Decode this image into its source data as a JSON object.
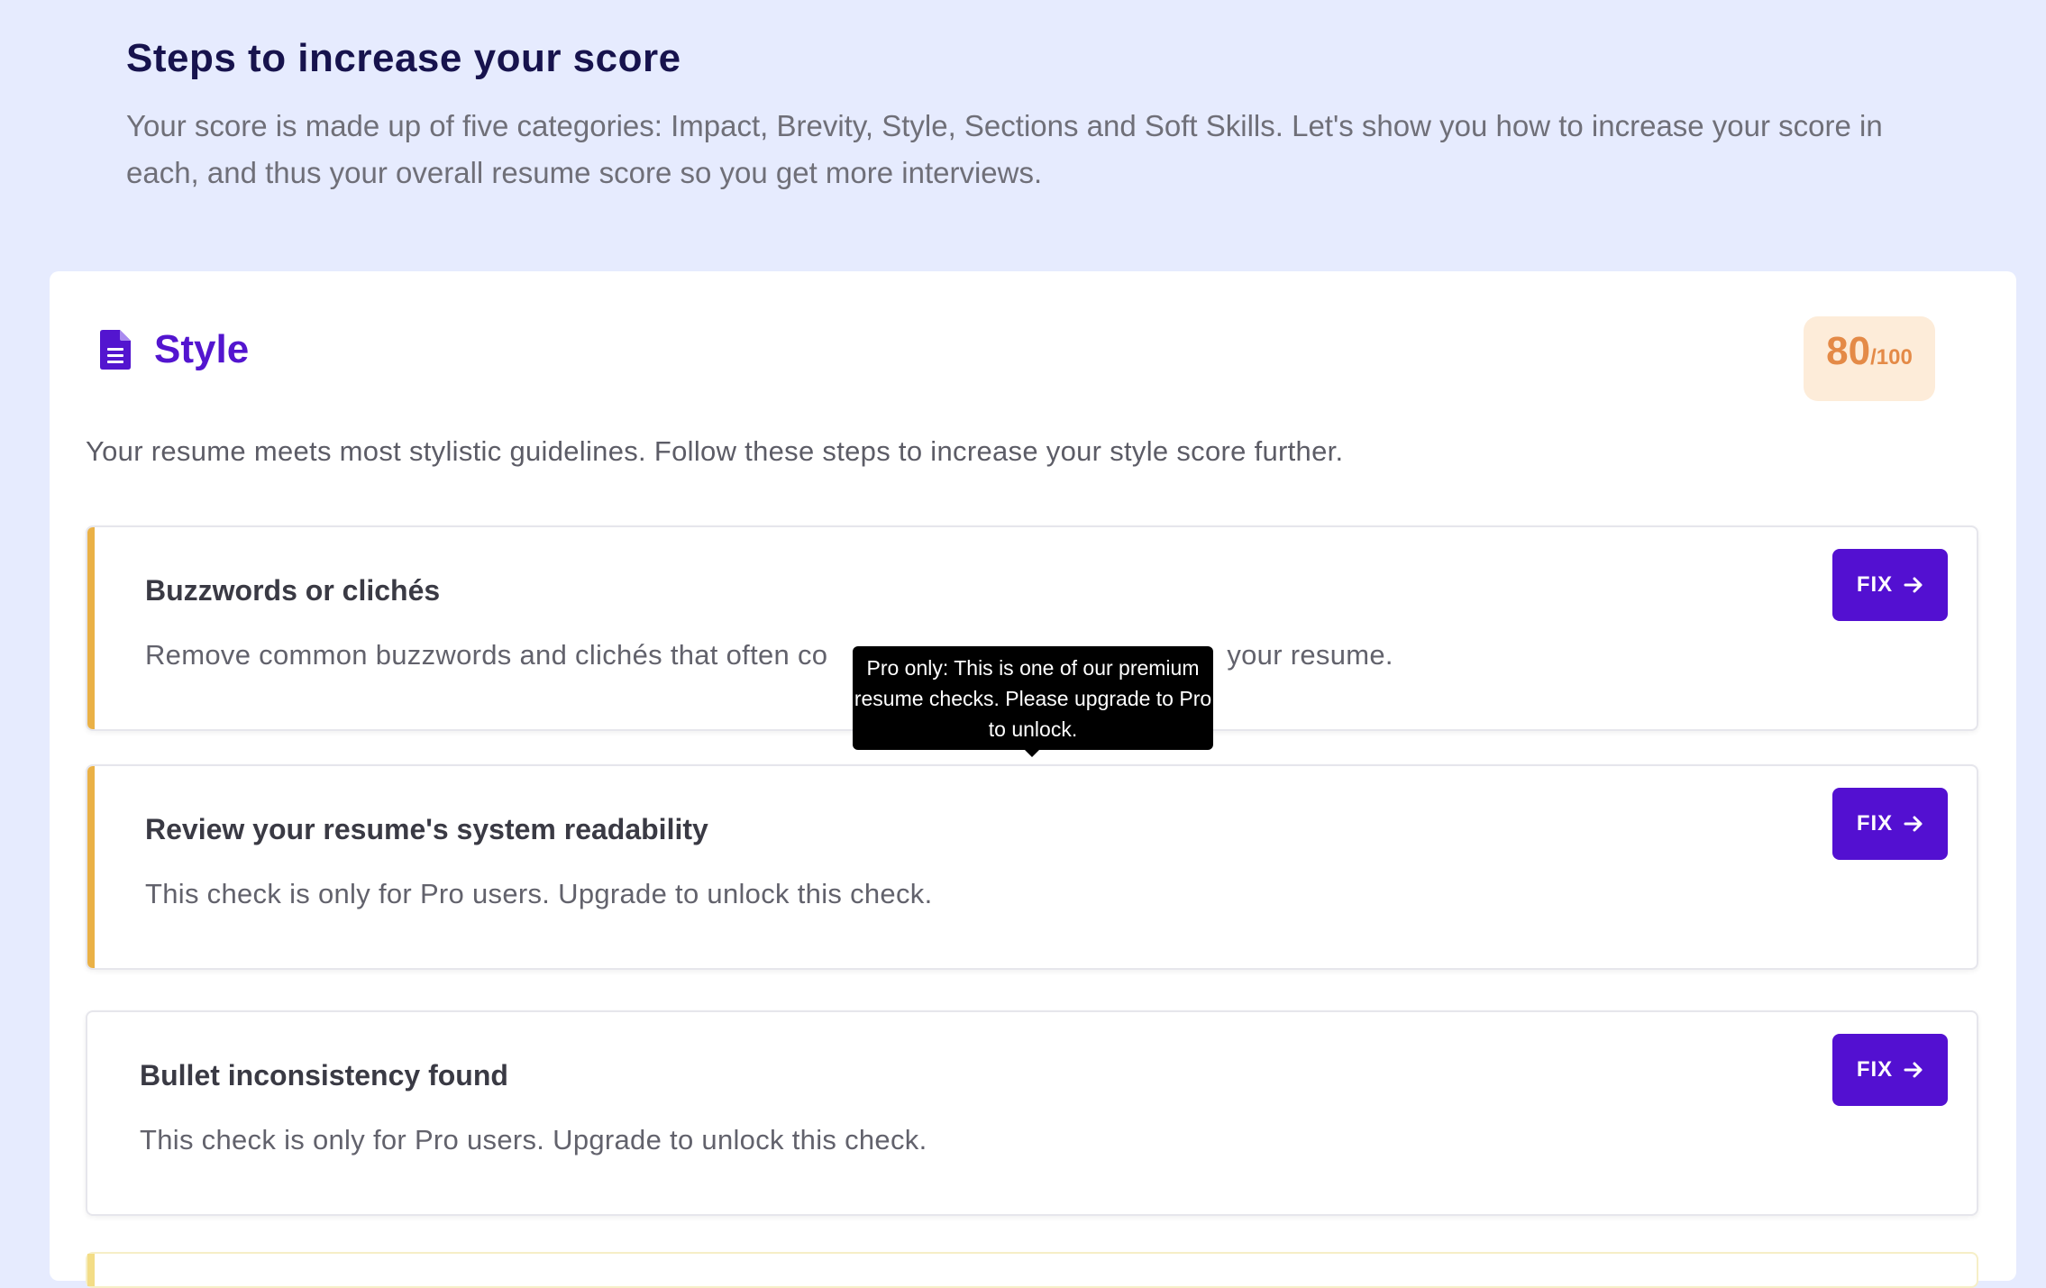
{
  "header": {
    "title": "Steps to increase your score",
    "description": "Your score is made up of five categories: Impact, Brevity, Style, Sections and Soft Skills. Let's show you how to increase your score in each, and thus your overall resume score so you get more interviews."
  },
  "section": {
    "icon": "document-icon",
    "title": "Style",
    "score": "80",
    "score_max": "/100",
    "description": "Your resume meets most stylistic guidelines. Follow these steps to increase your style score further."
  },
  "checks": [
    {
      "title": "Buzzwords or clichés",
      "description": "Remove common buzzwords and clichés that often co",
      "description_tail": "your resume.",
      "button_label": "FIX",
      "accent": true
    },
    {
      "title": "Review your resume's system readability",
      "description": "This check is only for Pro users. Upgrade to unlock this check.",
      "button_label": "FIX",
      "accent": true
    },
    {
      "title": "Bullet inconsistency found",
      "description": "This check is only for Pro users. Upgrade to unlock this check.",
      "button_label": "FIX",
      "accent": false
    }
  ],
  "tooltip": {
    "text": "Pro only: This is one of our premium resume checks. Please upgrade to Pro to unlock."
  },
  "colors": {
    "page_bg": "#e6ebfe",
    "heading": "#17134d",
    "brand_purple": "#5310d1",
    "accent_yellow": "#eab146",
    "score_orange": "#e48a47",
    "score_bg": "#fdecd9"
  }
}
